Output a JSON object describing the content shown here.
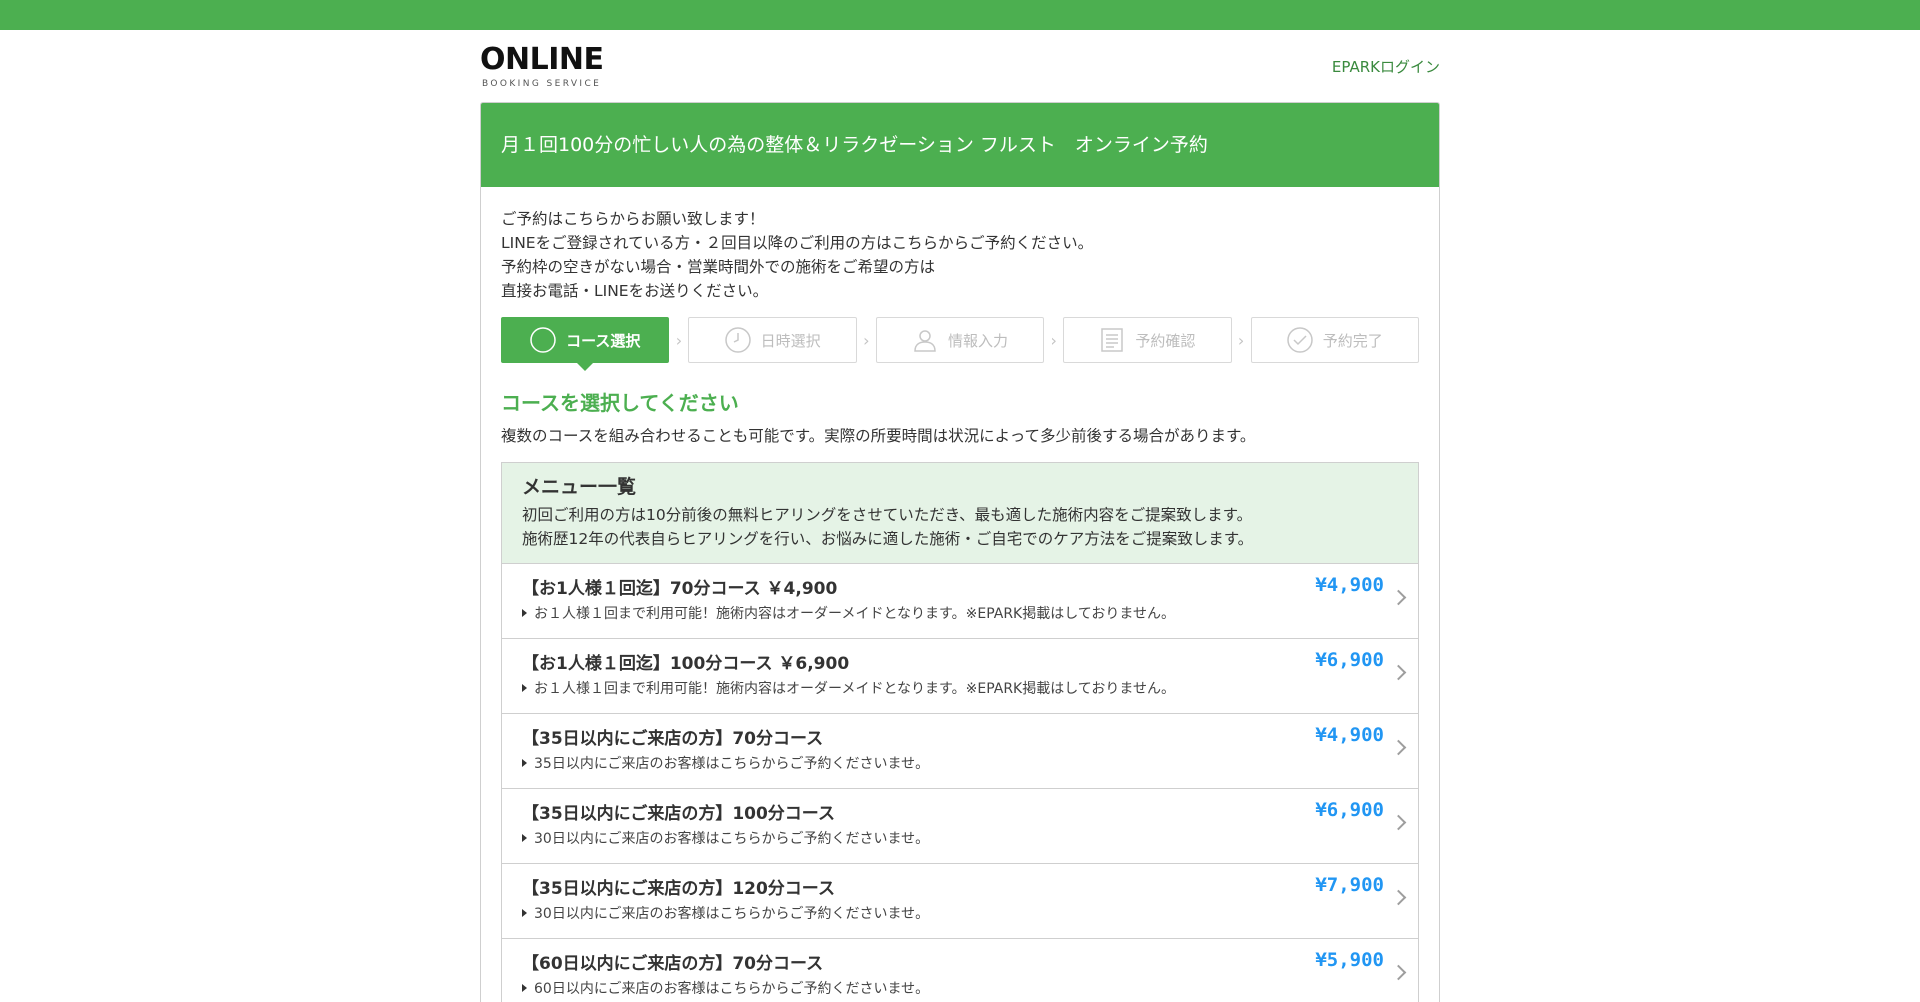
{
  "header": {
    "logo_main": "ONLINE",
    "logo_sub": "BOOKING SERVICE",
    "login_label": "EPARKログイン"
  },
  "card": {
    "title": "月１回100分の忙しい人の為の整体＆リラクゼーション フルスト　オンライン予約"
  },
  "intro": {
    "lines": [
      "ご予約はこちらからお願い致します！",
      "LINEをご登録されている方・２回目以降のご利用の方はこちらからご予約ください。",
      "予約枠の空きがない場合・営業時間外での施術をご希望の方は",
      "直接お電話・LINEをお送りください。"
    ]
  },
  "steps": [
    {
      "label": "コース選択",
      "icon": "circle-icon",
      "active": true
    },
    {
      "label": "日時選択",
      "icon": "clock-icon",
      "active": false
    },
    {
      "label": "情報入力",
      "icon": "person-icon",
      "active": false
    },
    {
      "label": "予約確認",
      "icon": "document-icon",
      "active": false
    },
    {
      "label": "予約完了",
      "icon": "check-circle-icon",
      "active": false
    }
  ],
  "section": {
    "title": "コースを選択してください",
    "desc": "複数のコースを組み合わせることも可能です。実際の所要時間は状況によって多少前後する場合があります。"
  },
  "menu": {
    "title": "メニュー一覧",
    "desc_lines": [
      "初回ご利用の方は10分前後の無料ヒアリングをさせていただき、最も適した施術内容をご提案致します。",
      "施術歴12年の代表自らヒアリングを行い、お悩みに適した施術・ご自宅でのケア方法をご提案致します。"
    ]
  },
  "courses": [
    {
      "name": "【お1人様１回迄】70分コース ￥4,900",
      "note": "お１人様１回まで利用可能！施術内容はオーダーメイドとなります。※EPARK掲載はしておりません。",
      "price": "¥4,900"
    },
    {
      "name": "【お1人様１回迄】100分コース ￥6,900",
      "note": "お１人様１回まで利用可能！施術内容はオーダーメイドとなります。※EPARK掲載はしておりません。",
      "price": "¥6,900"
    },
    {
      "name": "【35日以内にご来店の方】70分コース",
      "note": "35日以内にご来店のお客様はこちらからご予約くださいませ。",
      "price": "¥4,900"
    },
    {
      "name": "【35日以内にご来店の方】100分コース",
      "note": "30日以内にご来店のお客様はこちらからご予約くださいませ。",
      "price": "¥6,900"
    },
    {
      "name": "【35日以内にご来店の方】120分コース",
      "note": "30日以内にご来店のお客様はこちらからご予約くださいませ。",
      "price": "¥7,900"
    },
    {
      "name": "【60日以内にご来店の方】70分コース",
      "note": "60日以内にご来店のお客様はこちらからご予約くださいませ。",
      "price": "¥5,900"
    }
  ],
  "colors": {
    "brand_green": "#4caf50",
    "menu_head_bg": "#e5f3e6",
    "price_blue": "#2196f3",
    "login_green": "#3a8a3e"
  }
}
